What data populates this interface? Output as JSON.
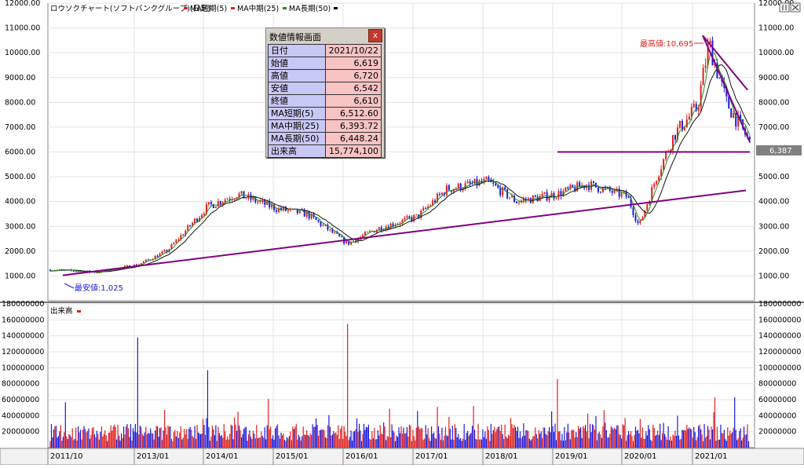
{
  "window": {
    "restore_icon": "restore-window-icon",
    "close_icon": "close-window-icon"
  },
  "price_panel": {
    "legend": {
      "title": "ロウソクチャート(ソフトバンクグループ)(日足)",
      "ma_short": "MA短期(5)",
      "ma_mid": "MA中期(25)",
      "ma_long": "MA長期(50)"
    },
    "y_ticks": [
      "12000.00",
      "11000.00",
      "10000.00",
      "9000.00",
      "8000.00",
      "7000.00",
      "6000.00",
      "5000.00",
      "4000.00",
      "3000.00",
      "2000.00",
      "1000.00"
    ],
    "current_price": "6,387",
    "max_label": "最高値:10,695",
    "min_label": "最安値:1,025"
  },
  "volume_panel": {
    "title": "出来高",
    "y_ticks": [
      "180000000",
      "160000000",
      "140000000",
      "120000000",
      "100000000",
      "80000000",
      "60000000",
      "40000000",
      "20000000"
    ]
  },
  "x_ticks": [
    "2011/10",
    "2013/01",
    "2014/01",
    "2015/01",
    "2016/01",
    "2017/01",
    "2018/01",
    "2019/01",
    "2020/01",
    "2021/01"
  ],
  "popup": {
    "title": "数値情報画面",
    "close_label": "x",
    "rows": [
      {
        "key": "日付",
        "value": "2021/10/22"
      },
      {
        "key": "始値",
        "value": "6,619"
      },
      {
        "key": "高値",
        "value": "6,720"
      },
      {
        "key": "安値",
        "value": "6,542"
      },
      {
        "key": "終値",
        "value": "6,610"
      },
      {
        "key": "MA短期(5)",
        "value": "6,512.60"
      },
      {
        "key": "MA中期(25)",
        "value": "6,393.72"
      },
      {
        "key": "MA長期(50)",
        "value": "6,448.24"
      },
      {
        "key": "出来高",
        "value": "15,774,100"
      }
    ]
  },
  "colors": {
    "up": "#e0201f",
    "down": "#1a1ae0",
    "ma_mid": "#1f8f1f",
    "ma_long": "#111111",
    "trendline": "#800080",
    "max_text": "#e0201f",
    "min_text": "#1a1ae0"
  },
  "chart_data": {
    "type": "candlestick",
    "price_series": {
      "x": [
        "2011/10",
        "2012/06",
        "2013/01",
        "2013/06",
        "2014/01",
        "2014/06",
        "2015/01",
        "2015/06",
        "2016/01",
        "2016/06",
        "2017/01",
        "2017/06",
        "2018/01",
        "2018/06",
        "2019/01",
        "2019/06",
        "2020/01",
        "2020/03",
        "2020/06",
        "2020/09",
        "2021/01",
        "2021/03",
        "2021/06",
        "2021/10"
      ],
      "close": [
        1250,
        1150,
        1450,
        2000,
        3800,
        4300,
        3700,
        3500,
        2300,
        2900,
        3400,
        4500,
        4800,
        4000,
        4300,
        4700,
        4200,
        3000,
        5000,
        6700,
        7800,
        10400,
        8000,
        6387
      ]
    },
    "price_ylim": [
      0,
      12000
    ],
    "volume_ylim": [
      0,
      180000000
    ],
    "volume_spikes": [
      {
        "x": "2013/01",
        "value": 138000000
      },
      {
        "x": "2016/01",
        "value": 155000000
      },
      {
        "x": "2014/01",
        "value": 97000000
      },
      {
        "x": "2019/01",
        "value": 86000000
      },
      {
        "x": "2021/10",
        "value": 70000000
      }
    ],
    "max": {
      "value": 10695,
      "x": "2021/03"
    },
    "min": {
      "value": 1025,
      "x": "2012/06"
    },
    "horizontal_line": 6000
  }
}
